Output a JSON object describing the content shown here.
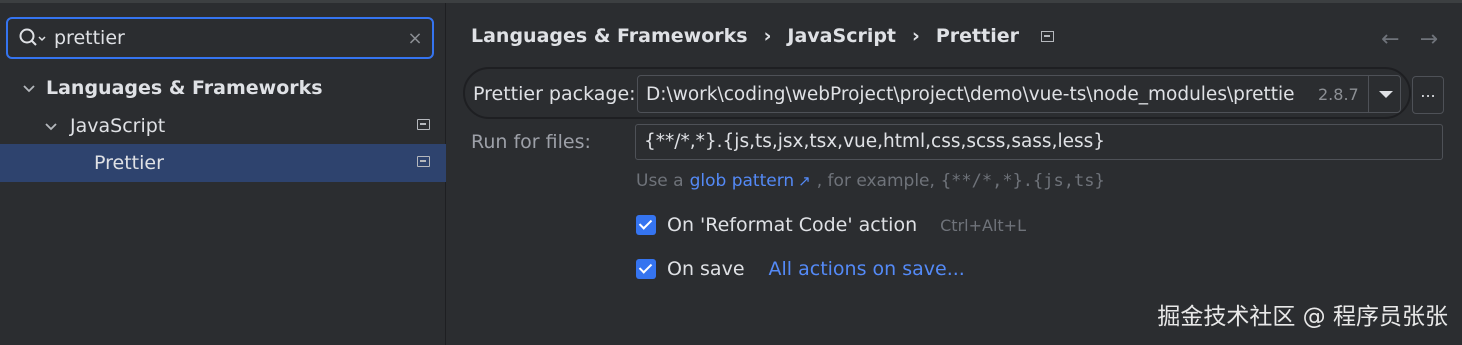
{
  "search": {
    "value": "prettier",
    "clear_glyph": "×"
  },
  "tree": {
    "items": [
      {
        "label": "Languages & Frameworks",
        "expanded": true
      },
      {
        "label": "JavaScript",
        "expanded": true
      },
      {
        "label": "Prettier",
        "selected": true
      }
    ]
  },
  "breadcrumb": {
    "items": [
      "Languages & Frameworks",
      "JavaScript",
      "Prettier"
    ],
    "separator": "›"
  },
  "nav": {
    "back": "←",
    "forward": "→"
  },
  "prettier_package": {
    "label": "Prettier package:",
    "path": "D:\\work\\coding\\webProject\\project\\demo\\vue-ts\\node_modules\\prettie",
    "version": "2.8.7",
    "more_button": "..."
  },
  "run_for_files": {
    "label": "Run for files:",
    "value": "{**/*,*}.{js,ts,jsx,tsx,vue,html,css,scss,sass,less}"
  },
  "hint": {
    "prefix": "Use a",
    "link": "glob pattern",
    "link_arrow": "↗",
    "middle": ", for example,",
    "example": "{**/*,*}.{js,ts}"
  },
  "reformat_checkbox": {
    "label": "On 'Reformat Code' action",
    "checked": true,
    "shortcut": "Ctrl+Alt+L"
  },
  "save_checkbox": {
    "label": "On save",
    "checked": true,
    "link": "All actions on save..."
  },
  "watermark": "掘金技术社区 @ 程序员张张",
  "colors": {
    "accent": "#3574f0",
    "link": "#548af7",
    "selection": "#2e436e",
    "background": "#2b2d30"
  }
}
